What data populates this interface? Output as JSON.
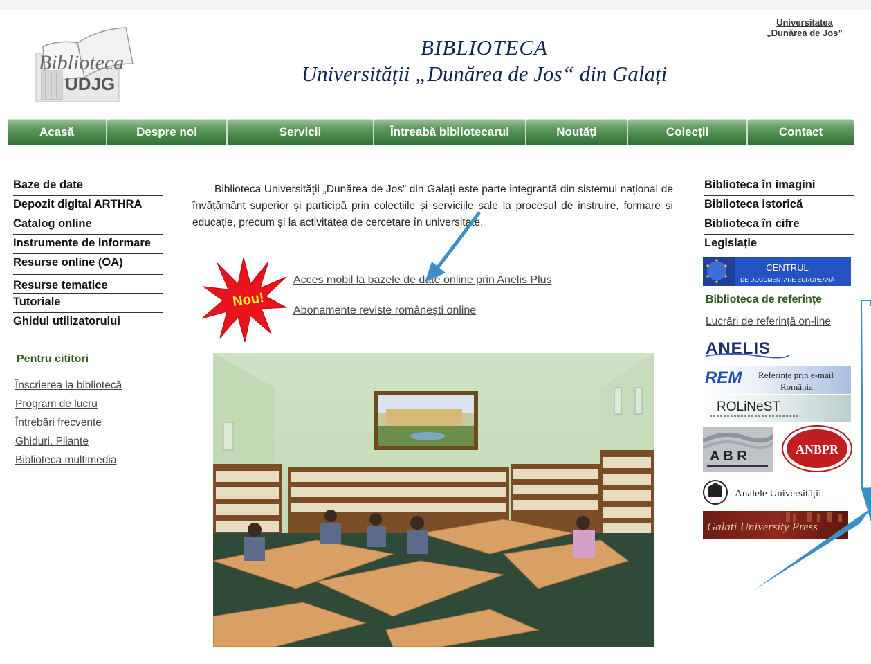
{
  "header": {
    "logo_script": "Biblioteca",
    "logo_abbr": "UDJG",
    "title_line1": "BIBLIOTECA",
    "title_line2": "Universității „Dunărea de Jos“ din Galați",
    "univ_link_line1": "Universitatea",
    "univ_link_line2": "„Dunărea de Jos”"
  },
  "nav": [
    {
      "label": "Acasă",
      "width": 0
    },
    {
      "label": "Despre noi"
    },
    {
      "label": "Servicii"
    },
    {
      "label": "Întreabă bibliotecarul"
    },
    {
      "label": "Noutăți"
    },
    {
      "label": "Colecții"
    },
    {
      "label": "Contact"
    }
  ],
  "left_menu": [
    "Baze de date",
    "Depozit digital ARTHRA",
    "Catalog online",
    "Instrumente de informare",
    "Resurse online (OA)",
    "Resurse tematice",
    "Tutoriale",
    "Ghidul utilizatorului"
  ],
  "pentru_cititori": {
    "heading": "Pentru cititori",
    "links": [
      "Înscrierea la bibliotecă",
      "Program de lucru",
      "Întrebări frecvente",
      "Ghiduri. Pliante",
      "Biblioteca multimedia"
    ]
  },
  "intro_text": "Biblioteca Universității „Dunărea de Jos” din Galați este parte integrantă din sistemul național de învățământ superior și participă prin colecțiile și serviciile sale la procesul de instruire, formare și educație, precum și la activitatea de cercetare în universitate.",
  "news": {
    "badge": "Nou!",
    "link1": "Acces mobil la bazele de date online prin Anelis Plus",
    "link2": "Abonamente reviste românești online"
  },
  "right_menu": [
    "Biblioteca în imagini",
    "Biblioteca istorică",
    "Biblioteca în cifre",
    "Legislație"
  ],
  "banners": {
    "cde_line1": "CENTRUL",
    "cde_line2": "DE DOCUMENTARE EUROPEANĂ",
    "bib_ref": "Biblioteca de referințe",
    "lucrari": "Lucrări de referință on-line",
    "anelis": "ANELIS",
    "rem": "REM",
    "rem_text1": "Referințe prin e-mail",
    "rem_text2": "România",
    "rolinest": "ROLiNeST",
    "abr": "A B R",
    "anbpr": "ANBPR",
    "analele": "Analele Universității",
    "gup": "Galati University Press"
  },
  "colors": {
    "nav_green": "#2f6f35",
    "heading_green": "#2e5a1c",
    "title_blue": "#0f2550",
    "arrow_blue": "#3b8fc2"
  }
}
